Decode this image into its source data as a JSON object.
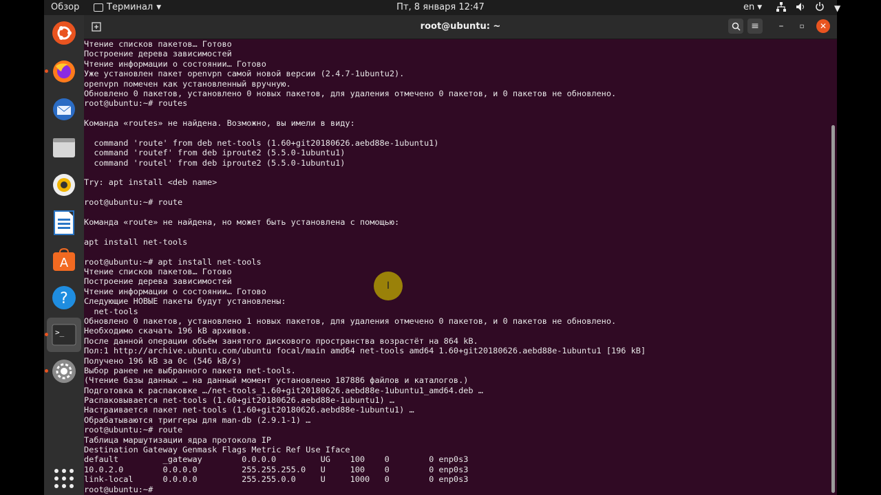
{
  "topbar": {
    "activities": "Обзор",
    "app_menu": "Терминал",
    "clock": "Пт, 8 января  12:47",
    "lang": "en"
  },
  "dock": {
    "apps": [
      {
        "name": "ubuntu-logo-icon"
      },
      {
        "name": "firefox-icon"
      },
      {
        "name": "thunderbird-icon"
      },
      {
        "name": "files-icon"
      },
      {
        "name": "rhythmbox-icon"
      },
      {
        "name": "libreoffice-writer-icon"
      },
      {
        "name": "ubuntu-software-icon"
      },
      {
        "name": "help-icon"
      },
      {
        "name": "terminal-icon"
      },
      {
        "name": "settings-icon"
      }
    ]
  },
  "window": {
    "title": "root@ubuntu: ~"
  },
  "terminal": {
    "lines": [
      "Чтение списков пакетов… Готово",
      "Построение дерева зависимостей",
      "Чтение информации о состоянии… Готово",
      "Уже установлен пакет openvpn самой новой версии (2.4.7-1ubuntu2).",
      "openvpn помечен как установленный вручную.",
      "Обновлено 0 пакетов, установлено 0 новых пакетов, для удаления отмечено 0 пакетов, и 0 пакетов не обновлено.",
      "root@ubuntu:~# routes",
      "",
      "Команда «routes» не найдена. Возможно, вы имели в виду:",
      "",
      "  command 'route' from deb net-tools (1.60+git20180626.aebd88e-1ubuntu1)",
      "  command 'routef' from deb iproute2 (5.5.0-1ubuntu1)",
      "  command 'routel' from deb iproute2 (5.5.0-1ubuntu1)",
      "",
      "Try: apt install <deb name>",
      "",
      "root@ubuntu:~# route",
      "",
      "Команда «route» не найдена, но может быть установлена с помощью:",
      "",
      "apt install net-tools",
      "",
      "root@ubuntu:~# apt install net-tools",
      "Чтение списков пакетов… Готово",
      "Построение дерева зависимостей",
      "Чтение информации о состоянии… Готово",
      "Следующие НОВЫЕ пакеты будут установлены:",
      "  net-tools",
      "Обновлено 0 пакетов, установлено 1 новых пакетов, для удаления отмечено 0 пакетов, и 0 пакетов не обновлено.",
      "Необходимо скачать 196 kB архивов.",
      "После данной операции объём занятого дискового пространства возрастёт на 864 kB.",
      "Пол:1 http://archive.ubuntu.com/ubuntu focal/main amd64 net-tools amd64 1.60+git20180626.aebd88e-1ubuntu1 [196 kB]",
      "Получено 196 kB за 0с (546 kB/s)",
      "Выбор ранее не выбранного пакета net-tools.",
      "(Чтение базы данных … на данный момент установлено 187886 файлов и каталогов.)",
      "Подготовка к распаковке …/net-tools_1.60+git20180626.aebd88e-1ubuntu1_amd64.deb …",
      "Распаковывается net-tools (1.60+git20180626.aebd88e-1ubuntu1) …",
      "Настраивается пакет net-tools (1.60+git20180626.aebd88e-1ubuntu1) …",
      "Обрабатываются триггеры для man-db (2.9.1-1) …",
      "root@ubuntu:~# route",
      "Таблица маршутизации ядра протокола IP",
      "Destination Gateway Genmask Flags Metric Ref Use Iface",
      "default         _gateway        0.0.0.0         UG    100    0        0 enp0s3",
      "10.0.2.0        0.0.0.0         255.255.255.0   U     100    0        0 enp0s3",
      "link-local      0.0.0.0         255.255.0.0     U     1000   0        0 enp0s3",
      "root@ubuntu:~# "
    ]
  }
}
